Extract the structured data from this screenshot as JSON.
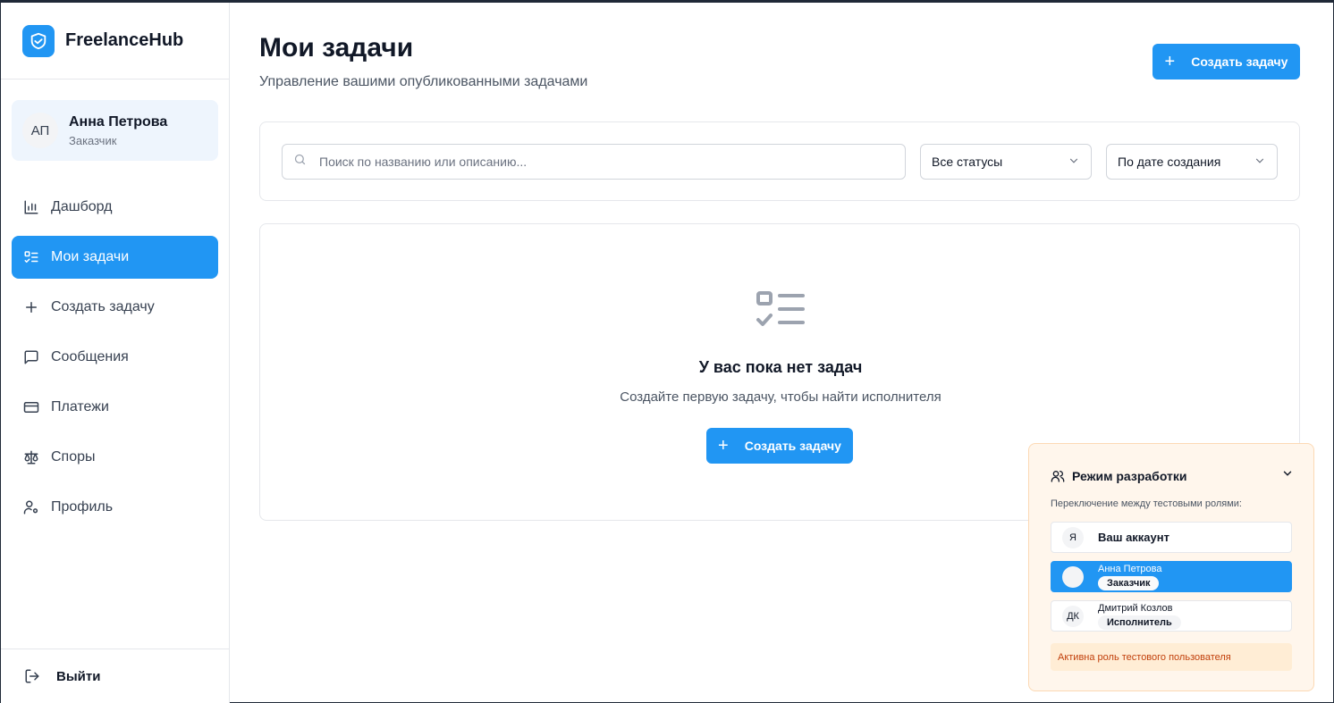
{
  "brand": {
    "name": "FreelanceHub",
    "logo_icon": "handshake-icon",
    "accent": "#2196f3"
  },
  "user": {
    "initials": "АП",
    "name": "Анна Петрова",
    "role": "Заказчик"
  },
  "nav": {
    "items": [
      {
        "label": "Дашборд",
        "icon": "bar-chart-icon",
        "active": false
      },
      {
        "label": "Мои задачи",
        "icon": "task-list-icon",
        "active": true
      },
      {
        "label": "Создать задачу",
        "icon": "plus-icon",
        "active": false
      },
      {
        "label": "Сообщения",
        "icon": "message-icon",
        "active": false
      },
      {
        "label": "Платежи",
        "icon": "credit-card-icon",
        "active": false
      },
      {
        "label": "Споры",
        "icon": "scale-icon",
        "active": false
      },
      {
        "label": "Профиль",
        "icon": "user-settings-icon",
        "active": false
      }
    ],
    "logout_label": "Выйти"
  },
  "page": {
    "title": "Мои задачи",
    "subtitle": "Управление вашими опубликованными задачами",
    "create_button": "Создать задачу"
  },
  "filters": {
    "search_placeholder": "Поиск по названию или описанию...",
    "search_value": "",
    "status_selected": "Все статусы",
    "sort_selected": "По дате создания"
  },
  "empty_state": {
    "title": "У вас пока нет задач",
    "text": "Создайте первую задачу, чтобы найти исполнителя",
    "button": "Создать задачу"
  },
  "dev_panel": {
    "title": "Режим разработки",
    "label": "Переключение между тестовыми ролями:",
    "roles": [
      {
        "initials": "Я",
        "name": "Ваш аккаунт",
        "badge": ""
      },
      {
        "initials": "",
        "name": "Анна Петрова",
        "badge": "Заказчик",
        "active": true
      },
      {
        "initials": "ДК",
        "name": "Дмитрий Козлов",
        "badge": "Исполнитель"
      }
    ],
    "note": "Активна роль тестового пользователя"
  }
}
